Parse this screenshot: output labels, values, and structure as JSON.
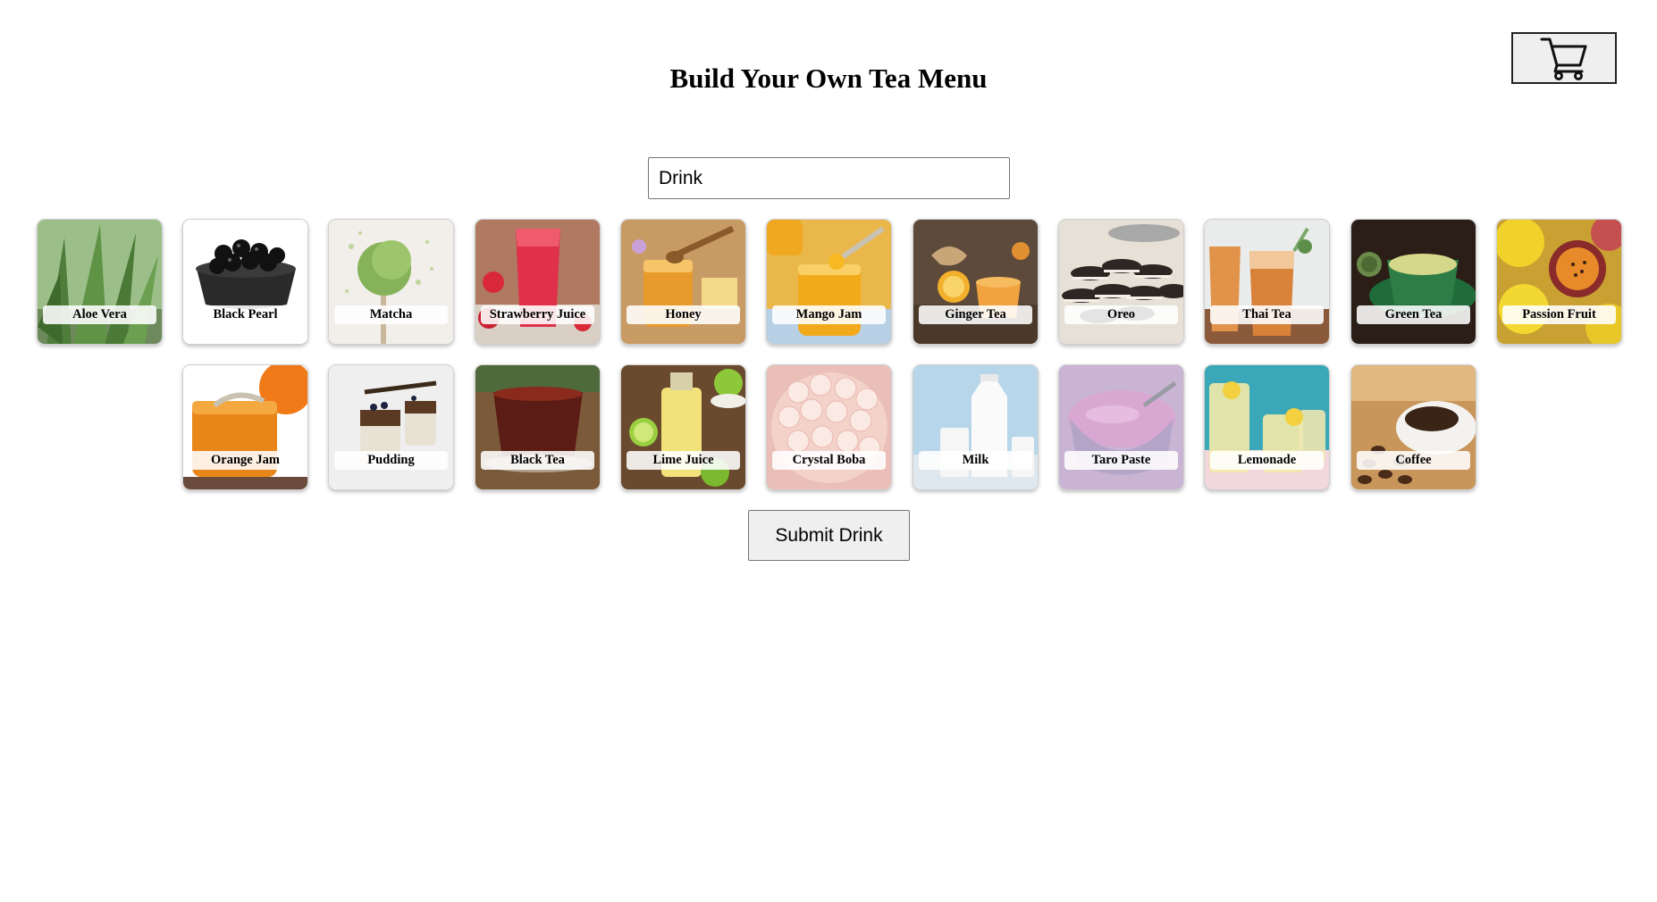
{
  "header": {
    "title": "Build Your Own Tea Menu",
    "cart_icon": "shopping-cart-icon"
  },
  "drink_name": {
    "value": "Drink",
    "placeholder": ""
  },
  "ingredients": [
    {
      "label": "Aloe Vera"
    },
    {
      "label": "Black Pearl"
    },
    {
      "label": "Matcha"
    },
    {
      "label": "Strawberry Juice"
    },
    {
      "label": "Honey"
    },
    {
      "label": "Mango Jam"
    },
    {
      "label": "Ginger Tea"
    },
    {
      "label": "Oreo"
    },
    {
      "label": "Thai Tea"
    },
    {
      "label": "Green Tea"
    },
    {
      "label": "Passion Fruit"
    },
    {
      "label": "Orange Jam"
    },
    {
      "label": "Pudding"
    },
    {
      "label": "Black Tea"
    },
    {
      "label": "Lime Juice"
    },
    {
      "label": "Crystal Boba"
    },
    {
      "label": "Milk"
    },
    {
      "label": "Taro Paste"
    },
    {
      "label": "Lemonade"
    },
    {
      "label": "Coffee"
    }
  ],
  "submit": {
    "label": "Submit Drink"
  }
}
